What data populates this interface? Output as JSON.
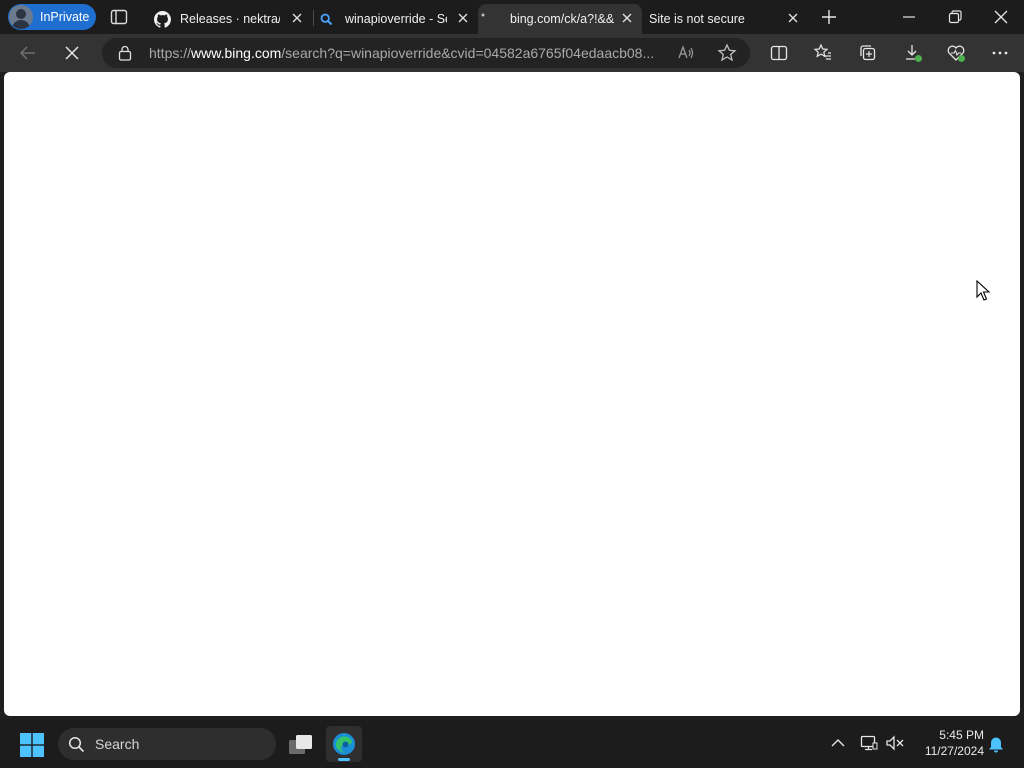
{
  "browser": {
    "profile_label": "InPrivate",
    "tabs": [
      {
        "title": "Releases · nektra/Sp",
        "icon": "github-icon",
        "active": false
      },
      {
        "title": "winapioverride - Se",
        "icon": "bing-search-icon",
        "active": false
      },
      {
        "title": "bing.com/ck/a?!&&",
        "icon": "loading-icon",
        "active": true
      },
      {
        "title": "Site is not secure",
        "icon": "none",
        "active": false
      }
    ],
    "address": {
      "protocol": "https://",
      "host": "www.bing.com",
      "path": "/search?q=winapioverride&cvid=04582a6765f04edaacb08..."
    }
  },
  "taskbar": {
    "search_label": "Search",
    "time": "5:45 PM",
    "date": "11/27/2024"
  },
  "colors": {
    "accent": "#1e6fd0",
    "taskbar_indicator": "#4cc2ff",
    "page_bg": "#ffffff"
  }
}
